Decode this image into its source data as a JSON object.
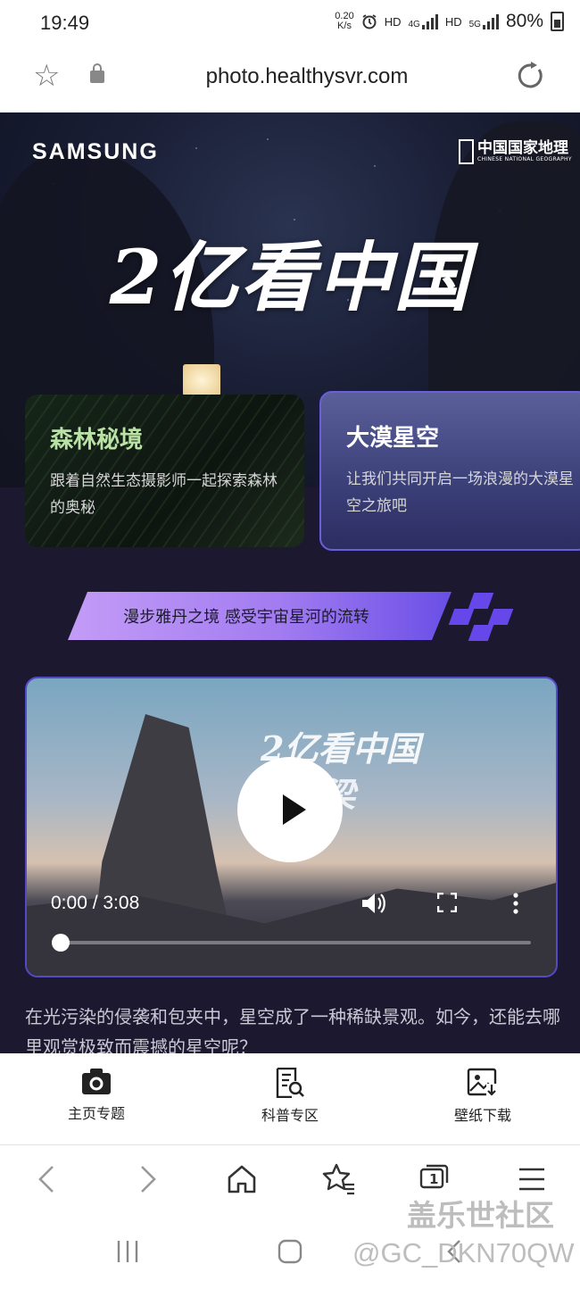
{
  "status_bar": {
    "time": "19:49",
    "net_speed_value": "0.20",
    "net_speed_unit": "K/s",
    "hd1": "HD",
    "lte": "4G",
    "hd2": "HD",
    "g5": "5G",
    "battery": "80%"
  },
  "browser": {
    "url": "photo.healthysvr.com"
  },
  "hero": {
    "brand_left": "SAMSUNG",
    "brand_right": "中国国家地理",
    "brand_right_en": "CHINESE NATIONAL GEOGRAPHY",
    "title": "2亿看中国"
  },
  "cards": [
    {
      "title": "森林秘境",
      "desc": "跟着自然生态摄影师一起探索森林的奥秘"
    },
    {
      "title": "大漠星空",
      "desc": "让我们共同开启一场浪漫的大漠星空之旅吧"
    }
  ],
  "banner": {
    "text": "漫步雅丹之境 感受宇宙星河的流转"
  },
  "video": {
    "overlay_title": "2亿看中国",
    "overlay_sub": "梁",
    "time": "0:00 / 3:08",
    "progress": 0
  },
  "article": {
    "text": "在光污染的侵袭和包夹中，星空成了一种稀缺景观。如今，还能去哪里观赏极致而震撼的星空呢？"
  },
  "bottom_tabs": [
    {
      "label": "主页专题",
      "icon": "camera-icon"
    },
    {
      "label": "科普专区",
      "icon": "search-doc-icon"
    },
    {
      "label": "壁纸下载",
      "icon": "image-download-icon"
    }
  ],
  "browser_nav": {
    "tabs_count": "1"
  },
  "watermark": {
    "community": "盖乐世社区",
    "handle": "@GC_DKN70QW"
  },
  "colors": {
    "accent_purple": "#6b5fd9",
    "forest_green": "#b9e2a4",
    "bg_dark": "#1b1830"
  }
}
